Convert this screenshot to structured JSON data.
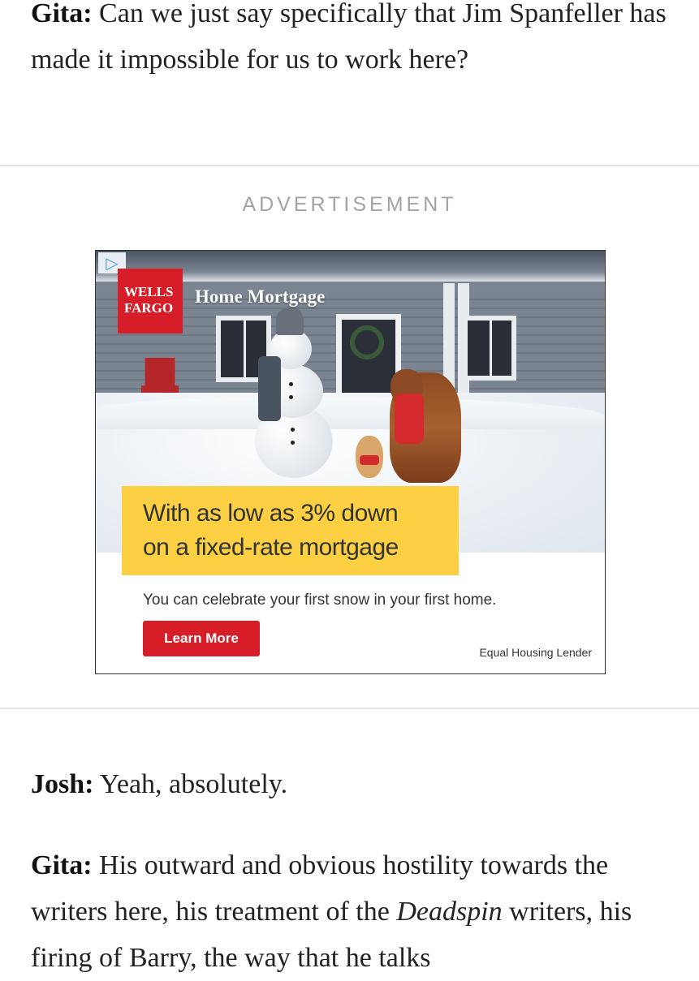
{
  "article": {
    "para1": {
      "speaker": "Gita:",
      "text": " Can we just say specifically that Jim Spanfeller has made it impossible for us to work here?"
    },
    "para2": {
      "speaker": "Josh:",
      "text": " Yeah, absolutely."
    },
    "para3": {
      "speaker": "Gita:",
      "text_before": " His outward and obvious hostility towards the writers here, his treatment of the ",
      "italic": "Deadspin",
      "text_after": " writers, his firing of Barry, the way that he talks"
    }
  },
  "ad_label": "ADVERTISEMENT",
  "ad": {
    "brand_line1": "WELLS",
    "brand_line2": "FARGO",
    "product": "Home Mortgage",
    "headline_line1": "With as low as 3% down",
    "headline_line2": "on a fixed-rate mortgage",
    "subline": "You can celebrate your first snow in your first home.",
    "cta": "Learn More",
    "disclaimer": "Equal Housing Lender",
    "adchoices_glyph": "▷",
    "colors": {
      "brand_red": "#d71e28",
      "highlight_yellow": "#fdd044"
    }
  }
}
